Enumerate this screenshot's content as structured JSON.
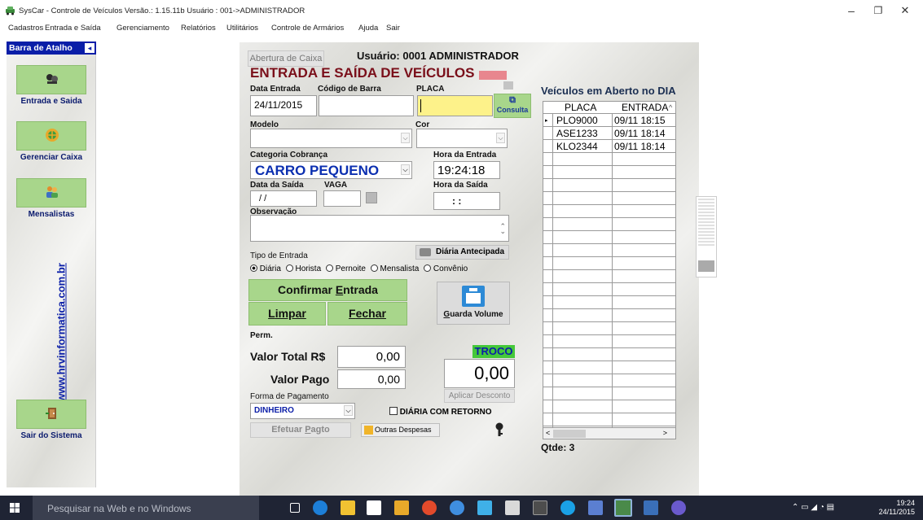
{
  "window": {
    "title": "SysCar - Controle de Veículos Versão.: 1.15.11b   Usuário : 001->ADMINISTRADOR",
    "minimize": "–",
    "restore": "❐",
    "close": "✕"
  },
  "menu": [
    "Cadastros",
    "Entrada e Saída",
    "Gerenciamento",
    "Relatórios",
    "Utilitários",
    "Controle de Armários",
    "Ajuda",
    "Sair"
  ],
  "sidebar": {
    "header": "Barra de Atalho",
    "collapse": "◂",
    "items": [
      "Entrada e Saida",
      "Gerenciar Caixa",
      "Mensalistas",
      "Sair do Sistema"
    ],
    "url": "www.hrvinformatica.com.br"
  },
  "form": {
    "abertura_caixa": "Abertura de Caixa",
    "usuario": "Usuário: 0001 ADMINISTRADOR",
    "heading": "ENTRADA E SAÍDA DE VEÍCULOS",
    "labels": {
      "data_entrada": "Data Entrada",
      "codigo_barra": "Código de Barra",
      "placa": "PLACA",
      "modelo": "Modelo",
      "cor": "Cor",
      "categoria": "Categoria Cobrança",
      "hora_entrada": "Hora da Entrada",
      "data_saida": "Data da Saída",
      "vaga": "VAGA",
      "hora_saida": "Hora da Saída",
      "observacao": "Observação",
      "tipo_entrada": "Tipo de Entrada",
      "perm": "Perm.",
      "valor_total": "Valor Total R$",
      "valor_pago": "Valor Pago",
      "troco": "TROCO",
      "forma_pagamento": "Forma de Pagamento"
    },
    "values": {
      "data_entrada": "24/11/2015",
      "codigo_barra": "",
      "placa": "",
      "categoria": "CARRO PEQUENO",
      "hora_entrada": "19:24:18",
      "data_saida": "/ /",
      "hora_saida": ": :",
      "valor_total": "0,00",
      "valor_pago": "0,00",
      "troco": "0,00",
      "forma_pagamento": "DINHEIRO"
    },
    "consulta": "Consulta",
    "diaria_antecipada": "Diária Antecipada",
    "radios": [
      "Diária",
      "Horista",
      "Pernoite",
      "Mensalista",
      "Convênio"
    ],
    "selected_radio": 0,
    "buttons": {
      "confirmar_pre": "Confirmar ",
      "confirmar_u": "E",
      "confirmar_post": "ntrada",
      "limpar_u": "L",
      "limpar_post": "impar",
      "fechar_u": "F",
      "fechar_post": "echar",
      "guarda_u": "G",
      "guarda_post": "uarda Volume",
      "aplicar_desconto": "Aplicar Desconto",
      "efetuar_pre": "Efetuar ",
      "efetuar_u": "P",
      "efetuar_post": "agto",
      "outras_despesas": "Outras Despesas"
    },
    "diaria_retorno": "DIÁRIA COM RETORNO"
  },
  "grid": {
    "title": "Veículos em Aberto no DIA",
    "columns": [
      "PLACA",
      "ENTRADA"
    ],
    "rows": [
      {
        "placa": "PLO9000",
        "entrada": "09/11 18:15"
      },
      {
        "placa": "ASE1233",
        "entrada": "09/11 18:14"
      },
      {
        "placa": "KLO2344",
        "entrada": "09/11 18:14"
      }
    ],
    "qtde": "Qtde: 3"
  },
  "taskbar": {
    "search_placeholder": "Pesquisar na Web e no Windows",
    "time": "19:24",
    "date": "24/11/2015"
  }
}
